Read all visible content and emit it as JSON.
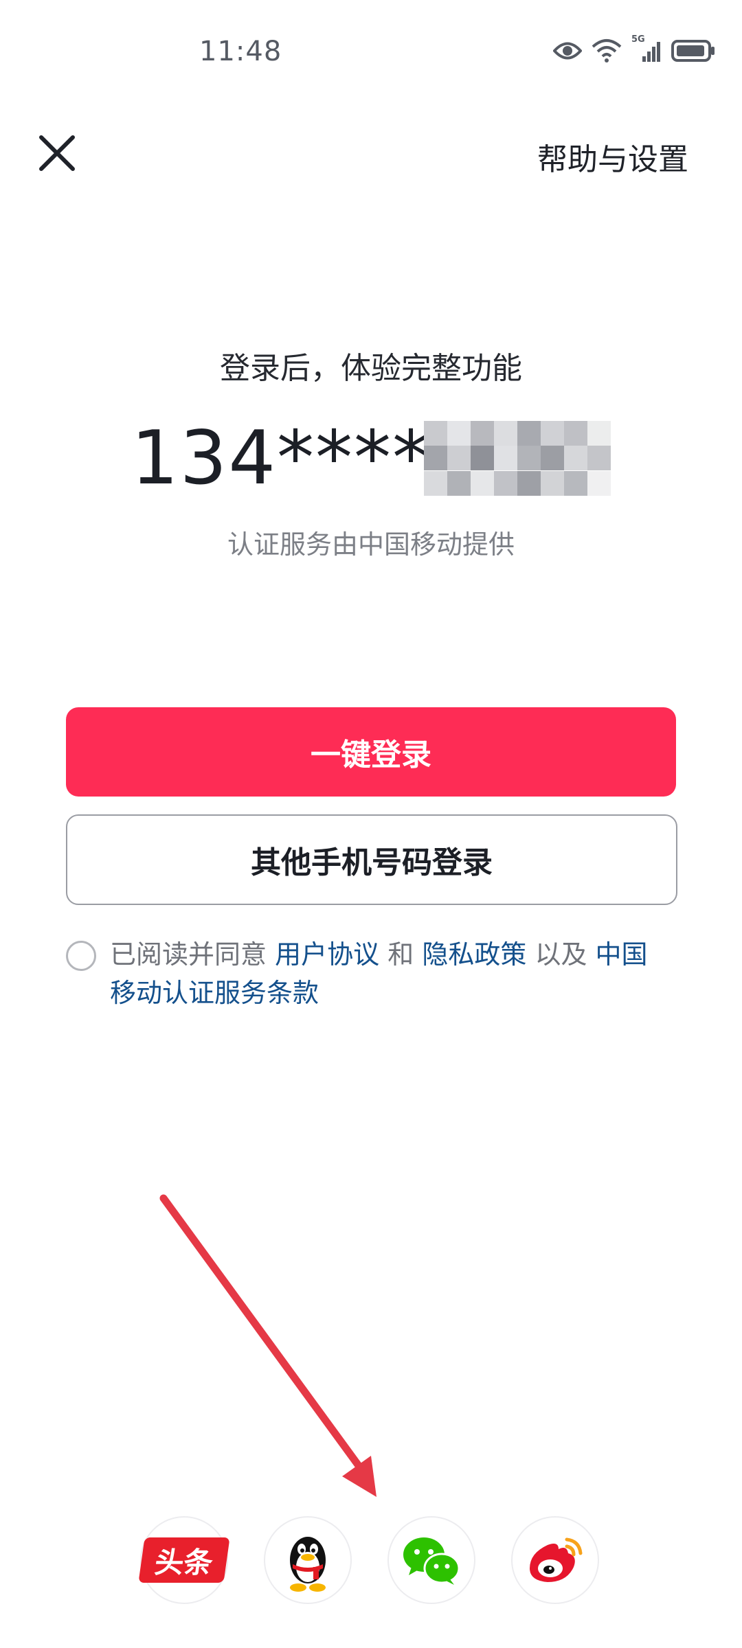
{
  "status_bar": {
    "time": "11:48",
    "network_label": "5G"
  },
  "header": {
    "close_icon": "close-icon",
    "help_label": "帮助与设置"
  },
  "main": {
    "headline": "登录后，体验完整功能",
    "phone_prefix": "134****",
    "provider_note": "认证服务由中国移动提供"
  },
  "buttons": {
    "one_click_login": "一键登录",
    "other_phone_login": "其他手机号码登录"
  },
  "agreement": {
    "prefix": "已阅读并同意",
    "user_agreement": "用户协议",
    "and": "和",
    "privacy_policy": "隐私政策",
    "as_well_as": "以及",
    "cmcc_terms": "中国移动认证服务条款"
  },
  "social": [
    {
      "name": "toutiao",
      "label": "头条",
      "icon": "toutiao-icon",
      "color": "#e8202c"
    },
    {
      "name": "qq",
      "icon": "qq-penguin-icon"
    },
    {
      "name": "wechat",
      "icon": "wechat-icon",
      "color": "#2dc100"
    },
    {
      "name": "weibo",
      "icon": "weibo-icon",
      "color": "#e6162d"
    }
  ],
  "colors": {
    "primary": "#fe2c55",
    "link": "#14508c",
    "annotation_arrow": "#e53946"
  }
}
